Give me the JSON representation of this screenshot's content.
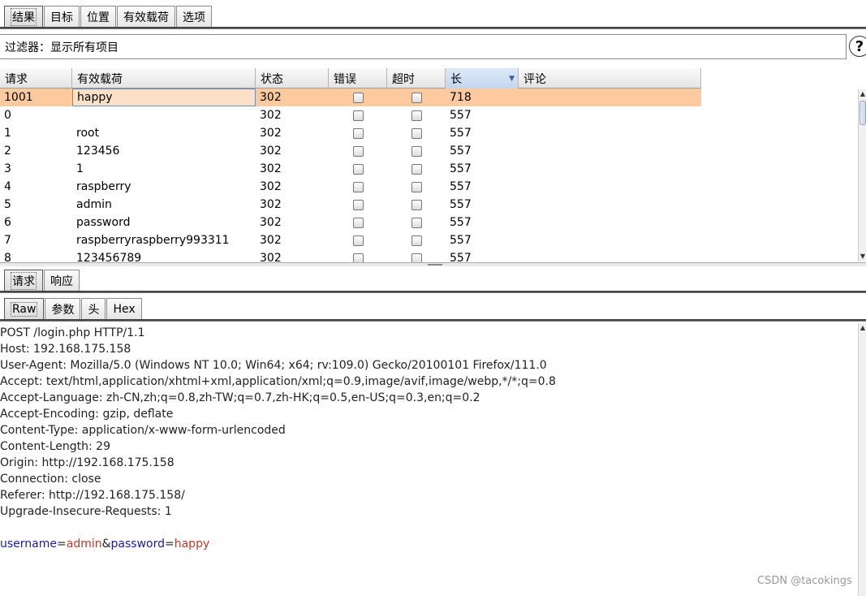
{
  "top_tabs": [
    "结果",
    "目标",
    "位置",
    "有效载荷",
    "选项"
  ],
  "filter": {
    "label": "过滤器：",
    "value": "显示所有项目"
  },
  "help_label": "?",
  "table": {
    "columns": [
      "请求",
      "有效载荷",
      "状态",
      "错误",
      "超时",
      "长",
      "评论"
    ],
    "sort_column": "长",
    "rows": [
      {
        "request": "1001",
        "payload": "happy",
        "status": "302",
        "error": false,
        "timeout": false,
        "length": "718",
        "comment": ""
      },
      {
        "request": "0",
        "payload": "",
        "status": "302",
        "error": false,
        "timeout": false,
        "length": "557",
        "comment": ""
      },
      {
        "request": "1",
        "payload": "root",
        "status": "302",
        "error": false,
        "timeout": false,
        "length": "557",
        "comment": ""
      },
      {
        "request": "2",
        "payload": "123456",
        "status": "302",
        "error": false,
        "timeout": false,
        "length": "557",
        "comment": ""
      },
      {
        "request": "3",
        "payload": "1",
        "status": "302",
        "error": false,
        "timeout": false,
        "length": "557",
        "comment": ""
      },
      {
        "request": "4",
        "payload": "raspberry",
        "status": "302",
        "error": false,
        "timeout": false,
        "length": "557",
        "comment": ""
      },
      {
        "request": "5",
        "payload": "admin",
        "status": "302",
        "error": false,
        "timeout": false,
        "length": "557",
        "comment": ""
      },
      {
        "request": "6",
        "payload": "password",
        "status": "302",
        "error": false,
        "timeout": false,
        "length": "557",
        "comment": ""
      },
      {
        "request": "7",
        "payload": "raspberryraspberry993311",
        "status": "302",
        "error": false,
        "timeout": false,
        "length": "557",
        "comment": ""
      },
      {
        "request": "8",
        "payload": "123456789",
        "status": "302",
        "error": false,
        "timeout": false,
        "length": "557",
        "comment": ""
      }
    ]
  },
  "req_tabs": [
    "请求",
    "响应"
  ],
  "view_tabs": [
    "Raw",
    "参数",
    "头",
    "Hex"
  ],
  "request_lines": [
    "POST /login.php HTTP/1.1",
    "Host: 192.168.175.158",
    "User-Agent: Mozilla/5.0 (Windows NT 10.0; Win64; x64; rv:109.0) Gecko/20100101 Firefox/111.0",
    "Accept: text/html,application/xhtml+xml,application/xml;q=0.9,image/avif,image/webp,*/*;q=0.8",
    "Accept-Language: zh-CN,zh;q=0.8,zh-TW;q=0.7,zh-HK;q=0.5,en-US;q=0.3,en;q=0.2",
    "Accept-Encoding: gzip, deflate",
    "Content-Type: application/x-www-form-urlencoded",
    "Content-Length: 29",
    "Origin: http://192.168.175.158",
    "Connection: close",
    "Referer: http://192.168.175.158/",
    "Upgrade-Insecure-Requests: 1",
    ""
  ],
  "body_params": {
    "p1_name": "username",
    "eq1": "=",
    "p1_value": "admin",
    "amp": "&",
    "p2_name": "password",
    "eq2": "=",
    "p2_value": "happy"
  },
  "watermark": "CSDN @tacokings",
  "colors": {
    "selected_row": "#fdc99f",
    "param_name": "#1a1aa6",
    "param_value": "#c0392b"
  }
}
